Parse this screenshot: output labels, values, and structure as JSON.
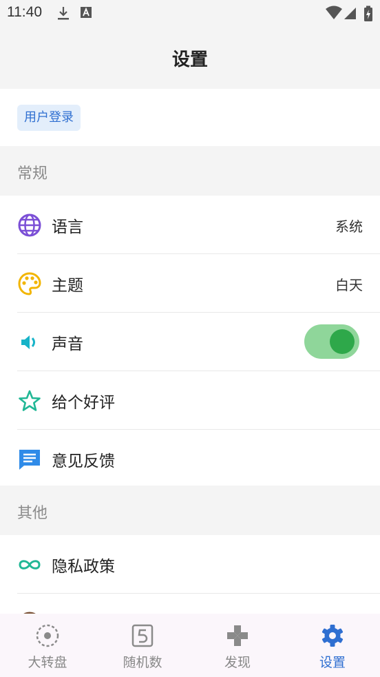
{
  "status_bar": {
    "time": "11:40"
  },
  "app_bar": {
    "title": "设置"
  },
  "login": {
    "label": "用户登录"
  },
  "sections": {
    "general": {
      "title": "常规",
      "language": {
        "label": "语言",
        "value": "系统"
      },
      "theme": {
        "label": "主题",
        "value": "白天"
      },
      "sound": {
        "label": "声音",
        "enabled": true
      },
      "rate": {
        "label": "给个好评"
      },
      "feedback": {
        "label": "意见反馈"
      }
    },
    "other": {
      "title": "其他",
      "privacy": {
        "label": "隐私政策"
      }
    }
  },
  "bottom_nav": [
    {
      "label": "大转盘",
      "icon": "wheel-icon"
    },
    {
      "label": "随机数",
      "icon": "dice-number-icon"
    },
    {
      "label": "发现",
      "icon": "gamepad-icon"
    },
    {
      "label": "设置",
      "icon": "gear-icon",
      "active": true
    }
  ],
  "colors": {
    "accent": "#2f6fd1",
    "toggle_on": "#2ea84a"
  }
}
